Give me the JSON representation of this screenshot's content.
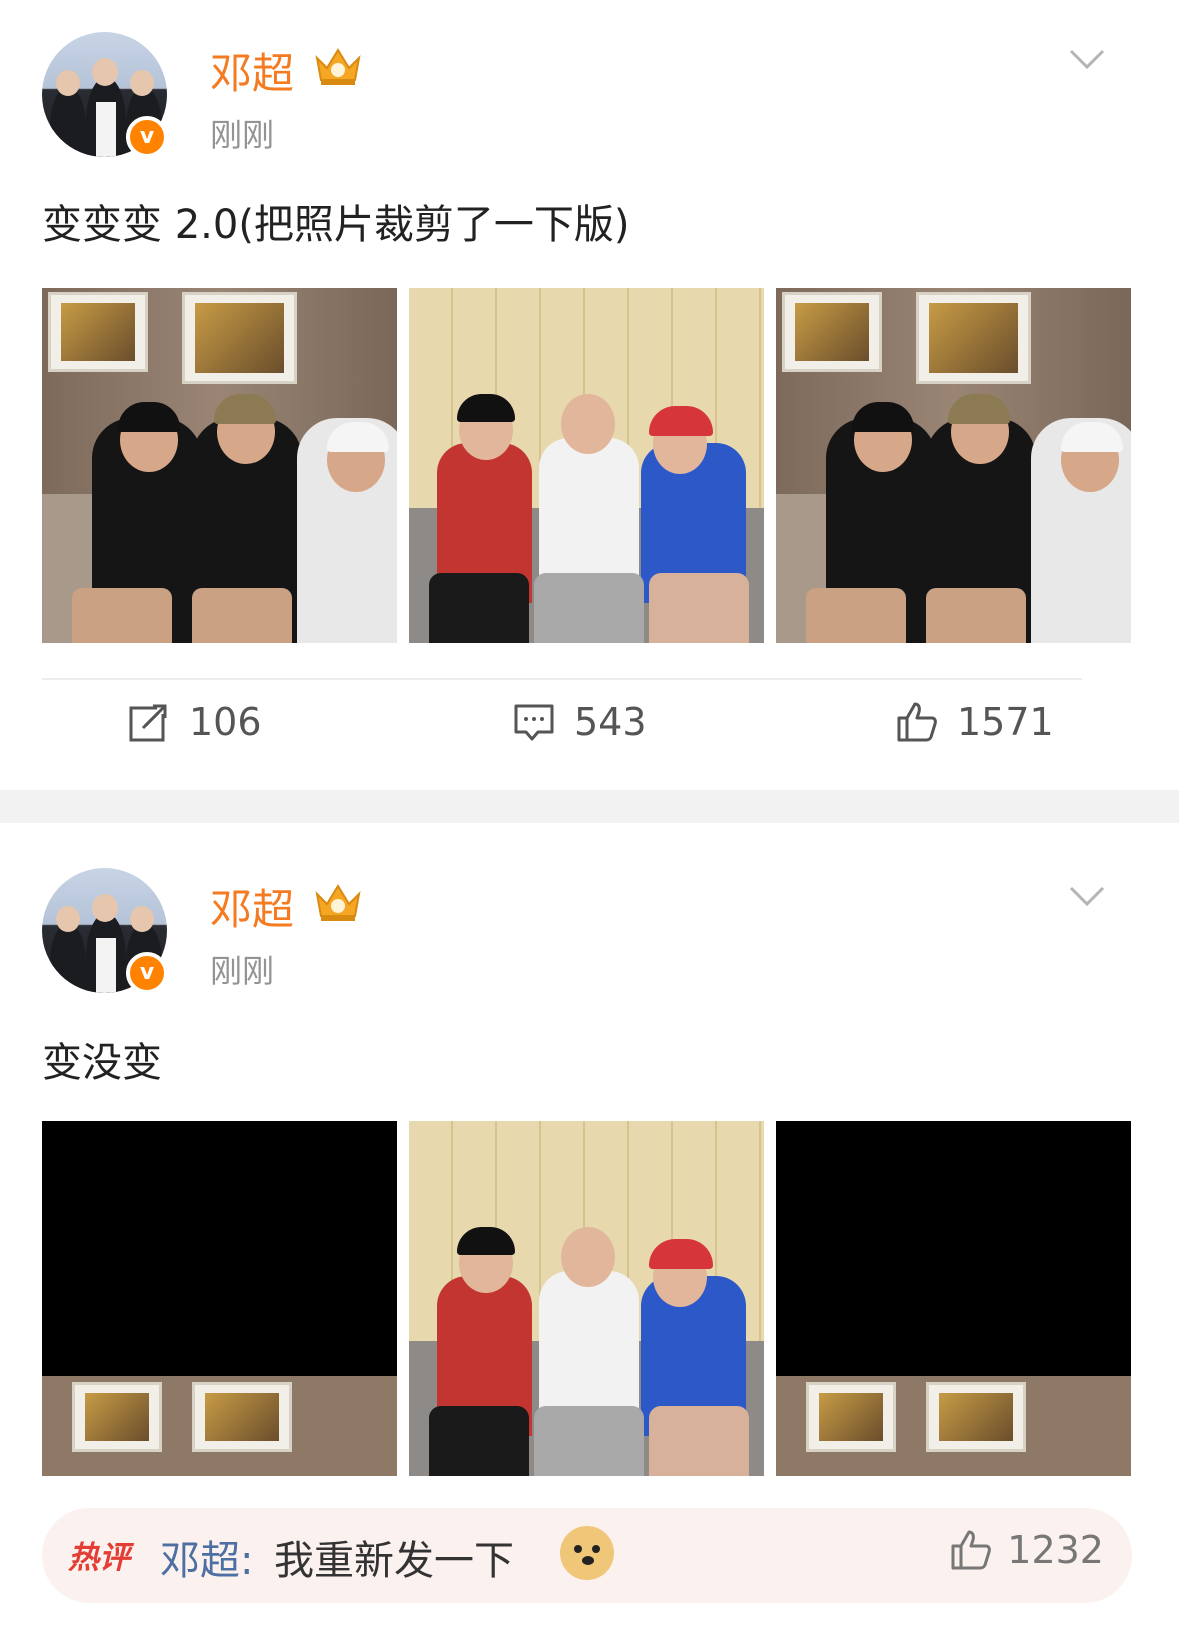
{
  "posts": [
    {
      "username": "邓超",
      "time": "刚刚",
      "text": "变变变 2.0(把照片裁剪了一下版)",
      "reposts": "106",
      "comments": "543",
      "likes": "1571",
      "photos": [
        "room",
        "beige",
        "room"
      ]
    },
    {
      "username": "邓超",
      "time": "刚刚",
      "text": "变没变",
      "photos": [
        "cropped",
        "beige",
        "cropped"
      ]
    }
  ],
  "hot_comment": {
    "tag": "热评",
    "author": "邓超:",
    "text": "我重新发一下",
    "emoji": "doge-icon",
    "likes": "1232"
  },
  "colors": {
    "username": "#f47b22",
    "verified_badge": "#ff8200",
    "hot_tag": "#e33e35",
    "comment_author": "#4e6fa3"
  }
}
